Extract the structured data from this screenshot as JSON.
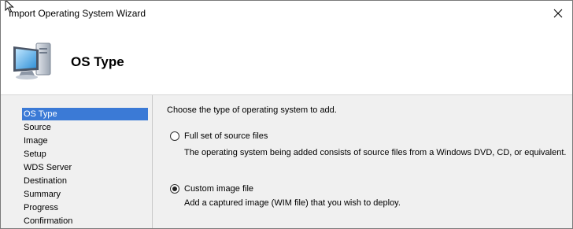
{
  "window": {
    "title": "Import Operating System Wizard",
    "close_icon": "close-icon"
  },
  "header": {
    "title": "OS Type",
    "icon": "computer-icon"
  },
  "nav": {
    "items": [
      {
        "label": "OS Type",
        "selected": true
      },
      {
        "label": "Source",
        "selected": false
      },
      {
        "label": "Image",
        "selected": false
      },
      {
        "label": "Setup",
        "selected": false
      },
      {
        "label": "WDS Server",
        "selected": false
      },
      {
        "label": "Destination",
        "selected": false
      },
      {
        "label": "Summary",
        "selected": false
      },
      {
        "label": "Progress",
        "selected": false
      },
      {
        "label": "Confirmation",
        "selected": false
      }
    ]
  },
  "content": {
    "instruction": "Choose the type of operating system to add.",
    "options": [
      {
        "label": "Full set of source files",
        "description": "The operating system being added consists of source files from a Windows DVD, CD, or equivalent.",
        "checked": false
      },
      {
        "label": "Custom image file",
        "description": "Add a captured image (WIM file) that you wish to deploy.",
        "checked": true
      }
    ]
  },
  "colors": {
    "selection": "#3b7ad6",
    "panel_background": "#f0f0f0"
  }
}
